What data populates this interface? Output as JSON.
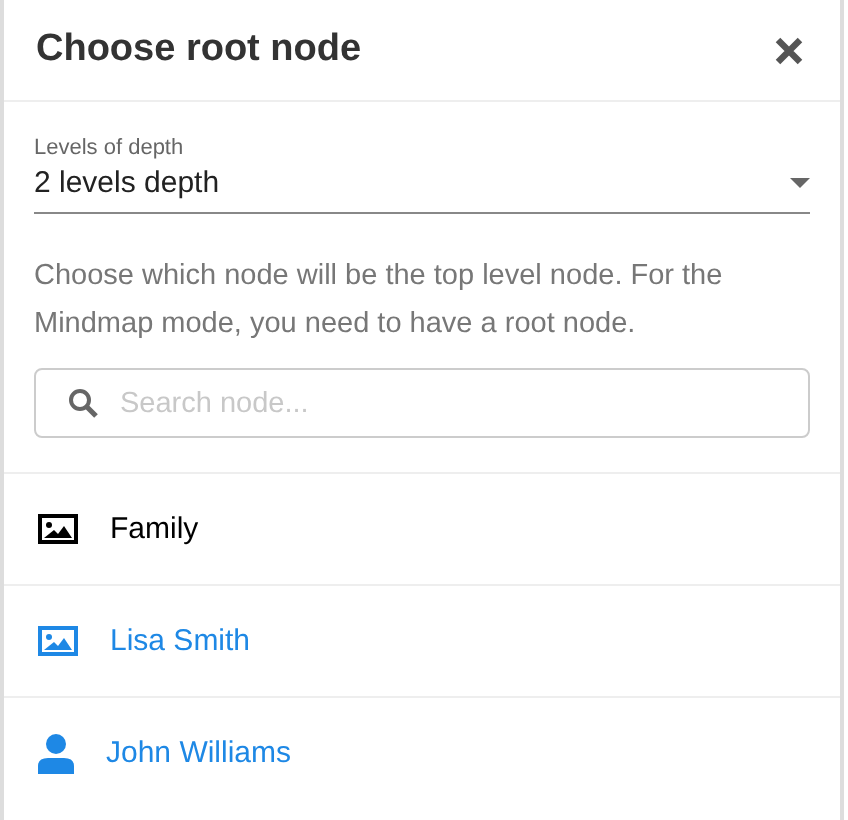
{
  "dialog": {
    "title": "Choose root node"
  },
  "depth_select": {
    "label": "Levels of depth",
    "value": "2 levels depth"
  },
  "description": "Choose which node will be the top level node. For the Mindmap mode, you need to have a root node.",
  "search": {
    "placeholder": "Search node..."
  },
  "nodes": [
    {
      "label": "Family",
      "kind": "image",
      "color": "#000000"
    },
    {
      "label": "Lisa Smith",
      "kind": "image",
      "color": "#1e88e5"
    },
    {
      "label": "John Williams",
      "kind": "person",
      "color": "#1e88e5"
    }
  ]
}
